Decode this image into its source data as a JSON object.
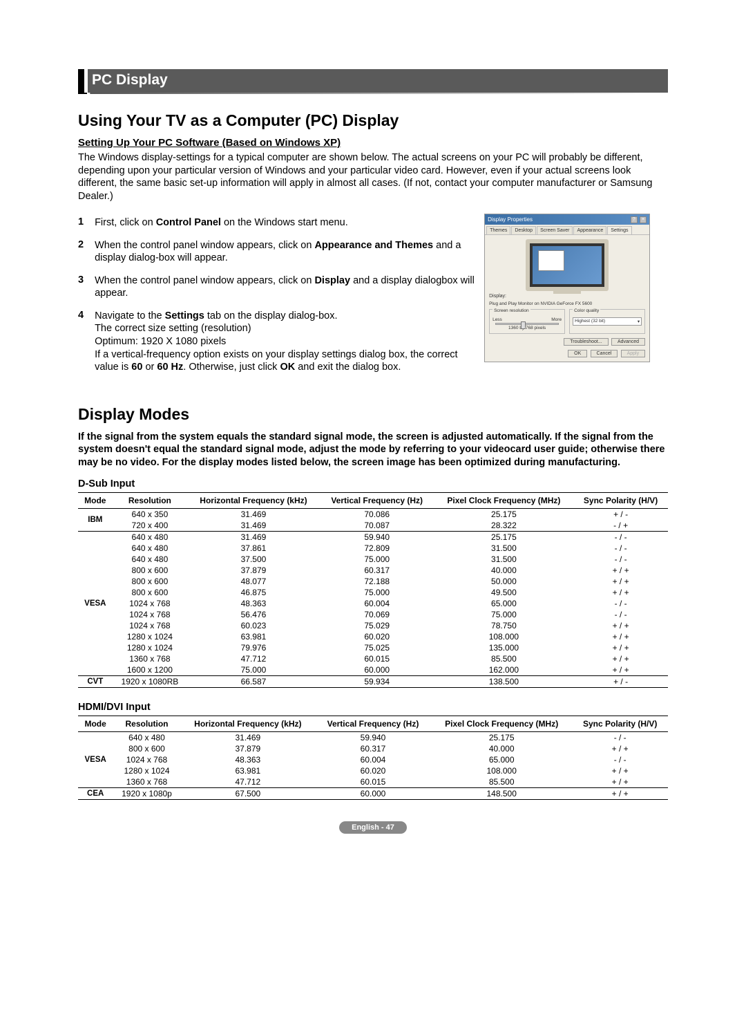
{
  "chapterTitle": "PC Display",
  "heading1": "Using Your TV as a Computer (PC) Display",
  "setupHeading": "Setting Up Your PC Software (Based on Windows XP)",
  "setupText": "The Windows display-settings for a typical computer are shown below. The actual screens on your PC will probably be different, depending upon your particular version of Windows and your particular video card. However, even if your actual screens look different, the same basic set-up information will apply in almost all cases. (If not, contact your computer manufacturer or Samsung Dealer.)",
  "steps": [
    {
      "num": "1",
      "html": "First, click on <b>Control Panel</b> on the Windows start menu."
    },
    {
      "num": "2",
      "html": "When the control panel window appears, click on <b>Appearance and Themes</b> and a display dialog-box will appear."
    },
    {
      "num": "3",
      "html": "When the control panel window appears, click on <b>Display</b> and a display dialogbox will appear."
    },
    {
      "num": "4",
      "html": "Navigate to the <b>Settings</b> tab on the display dialog-box.<br>The correct size setting (resolution)<br>Optimum: 1920 X 1080 pixels<br>If a vertical-frequency option exists on your display settings dialog box, the correct value is <b>60</b> or <b>60 Hz</b>. Otherwise, just click <b>OK</b> and exit the dialog box."
    }
  ],
  "dialog": {
    "title": "Display Properties",
    "tabs": [
      "Themes",
      "Desktop",
      "Screen Saver",
      "Appearance",
      "Settings"
    ],
    "displayLabel": "Display:",
    "displayValue": "Plug and Play Monitor on NVIDIA GeForce FX 5600",
    "screenResLabel": "Screen resolution",
    "less": "Less",
    "more": "More",
    "resValue": "1360 by 768 pixels",
    "colorLabel": "Color quality",
    "colorValue": "Highest (32 bit)",
    "troubleshoot": "Troubleshoot...",
    "advanced": "Advanced",
    "ok": "OK",
    "cancel": "Cancel",
    "apply": "Apply"
  },
  "heading2": "Display Modes",
  "modesIntro": "If the signal from the system equals the standard signal mode, the screen is adjusted automatically. If the signal from the system doesn't equal the standard signal mode, adjust the mode by referring to your videocard user guide; otherwise there may be no video. For the display modes listed below, the screen image has been optimized during manufacturing.",
  "dsubLabel": "D-Sub Input",
  "hdmiLabel": "HDMI/DVI Input",
  "columns": [
    "Mode",
    "Resolution",
    "Horizontal Frequency (kHz)",
    "Vertical Frequency (Hz)",
    "Pixel Clock Frequency (MHz)",
    "Sync Polarity (H/V)"
  ],
  "dsubGroups": [
    {
      "mode": "IBM",
      "rows": [
        [
          "640 x 350",
          "31.469",
          "70.086",
          "25.175",
          "+ / -"
        ],
        [
          "720 x 400",
          "31.469",
          "70.087",
          "28.322",
          "- / +"
        ]
      ]
    },
    {
      "mode": "VESA",
      "rows": [
        [
          "640 x 480",
          "31.469",
          "59.940",
          "25.175",
          "- / -"
        ],
        [
          "640 x 480",
          "37.861",
          "72.809",
          "31.500",
          "- / -"
        ],
        [
          "640 x 480",
          "37.500",
          "75.000",
          "31.500",
          "- / -"
        ],
        [
          "800 x 600",
          "37.879",
          "60.317",
          "40.000",
          "+ / +"
        ],
        [
          "800 x 600",
          "48.077",
          "72.188",
          "50.000",
          "+ / +"
        ],
        [
          "800 x 600",
          "46.875",
          "75.000",
          "49.500",
          "+ / +"
        ],
        [
          "1024 x 768",
          "48.363",
          "60.004",
          "65.000",
          "- / -"
        ],
        [
          "1024 x 768",
          "56.476",
          "70.069",
          "75.000",
          "- / -"
        ],
        [
          "1024 x 768",
          "60.023",
          "75.029",
          "78.750",
          "+ / +"
        ],
        [
          "1280 x 1024",
          "63.981",
          "60.020",
          "108.000",
          "+ / +"
        ],
        [
          "1280 x 1024",
          "79.976",
          "75.025",
          "135.000",
          "+ / +"
        ],
        [
          "1360 x 768",
          "47.712",
          "60.015",
          "85.500",
          "+ / +"
        ],
        [
          "1600 x 1200",
          "75.000",
          "60.000",
          "162.000",
          "+ / +"
        ]
      ]
    },
    {
      "mode": "CVT",
      "rows": [
        [
          "1920 x 1080RB",
          "66.587",
          "59.934",
          "138.500",
          "+ / -"
        ]
      ]
    }
  ],
  "hdmiGroups": [
    {
      "mode": "VESA",
      "rows": [
        [
          "640 x 480",
          "31.469",
          "59.940",
          "25.175",
          "- / -"
        ],
        [
          "800 x 600",
          "37.879",
          "60.317",
          "40.000",
          "+ / +"
        ],
        [
          "1024 x 768",
          "48.363",
          "60.004",
          "65.000",
          "- / -"
        ],
        [
          "1280 x 1024",
          "63.981",
          "60.020",
          "108.000",
          "+ / +"
        ],
        [
          "1360 x 768",
          "47.712",
          "60.015",
          "85.500",
          "+ / +"
        ]
      ]
    },
    {
      "mode": "CEA",
      "rows": [
        [
          "1920 x 1080p",
          "67.500",
          "60.000",
          "148.500",
          "+ / +"
        ]
      ]
    }
  ],
  "footer": "English - 47"
}
